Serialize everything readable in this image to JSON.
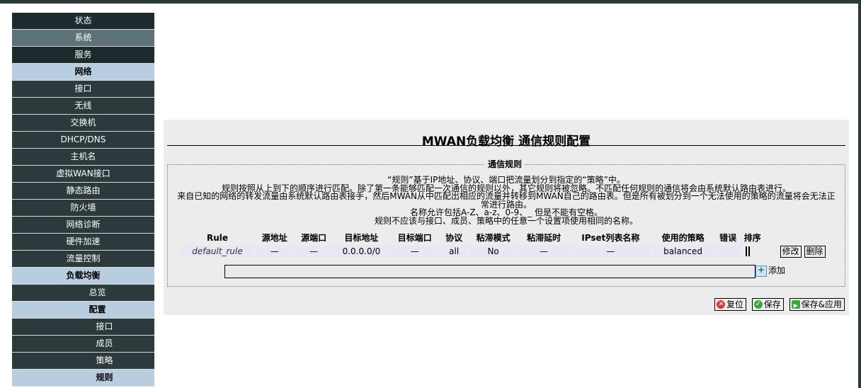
{
  "sidebar": {
    "items": [
      {
        "label": "状态",
        "level": "l1"
      },
      {
        "label": "系统",
        "level": "l1",
        "active": true
      },
      {
        "label": "服务",
        "level": "l1"
      },
      {
        "label": "网络",
        "level": "sec"
      },
      {
        "label": "接口",
        "level": "l2"
      },
      {
        "label": "无线",
        "level": "l2"
      },
      {
        "label": "交换机",
        "level": "l2"
      },
      {
        "label": "DHCP/DNS",
        "level": "l2"
      },
      {
        "label": "主机名",
        "level": "l2"
      },
      {
        "label": "虚拟WAN接口",
        "level": "l2"
      },
      {
        "label": "静态路由",
        "level": "l2"
      },
      {
        "label": "防火墙",
        "level": "l2"
      },
      {
        "label": "网络诊断",
        "level": "l2"
      },
      {
        "label": "硬件加速",
        "level": "l2"
      },
      {
        "label": "流量控制",
        "level": "l2"
      },
      {
        "label": "负载均衡",
        "level": "sec"
      },
      {
        "label": "总览",
        "level": "l2"
      },
      {
        "label": "配置",
        "level": "sec"
      },
      {
        "label": "接口",
        "level": "l3"
      },
      {
        "label": "成员",
        "level": "l3"
      },
      {
        "label": "策略",
        "level": "l3"
      },
      {
        "label": "规则",
        "level": "sec3"
      }
    ]
  },
  "page": {
    "title": "MWAN负载均衡 通信规则配置",
    "legend": "通信规则",
    "desc": [
      "“规则”基于IP地址、协议、端口把流量划分到指定的“策略”中。",
      "规则按照从上到下的顺序进行匹配。除了第一条能够匹配一次通信的规则以外，其它规则将被忽略。不匹配任何规则的通信将会由系统默认路由表进行。",
      "来自已知的网络的转发流量由系统默认路由表接手，然后MWAN从中匹配出相应的流量并转移到MWAN自己的路由表。但是所有被划分到一个无法使用的策略的流量将会无法正常进行路由。",
      "名称允许包括A-Z、a-z、0-9、_ 但是不能有空格。",
      "规则不应该与接口、成员、策略中的任意一个设置项使用相同的名称。"
    ]
  },
  "table": {
    "headers": [
      "Rule",
      "源地址",
      "源端口",
      "目标地址",
      "目标端口",
      "协议",
      "粘滞模式",
      "粘滞延时",
      "IPset列表名称",
      "使用的策略",
      "错误",
      "排序"
    ],
    "rows": [
      {
        "rule": "default_rule",
        "src": "—",
        "sport": "—",
        "dest": "0.0.0.0/0",
        "dport": "—",
        "proto": "all",
        "sticky": "No",
        "timeout": "—",
        "ipset": "—",
        "policy": "balanced",
        "error": ""
      }
    ],
    "edit_label": "修改",
    "delete_label": "删除",
    "add_label": "添加",
    "add_value": ""
  },
  "actions": {
    "reset": "复位",
    "save": "保存",
    "apply": "保存&应用"
  }
}
